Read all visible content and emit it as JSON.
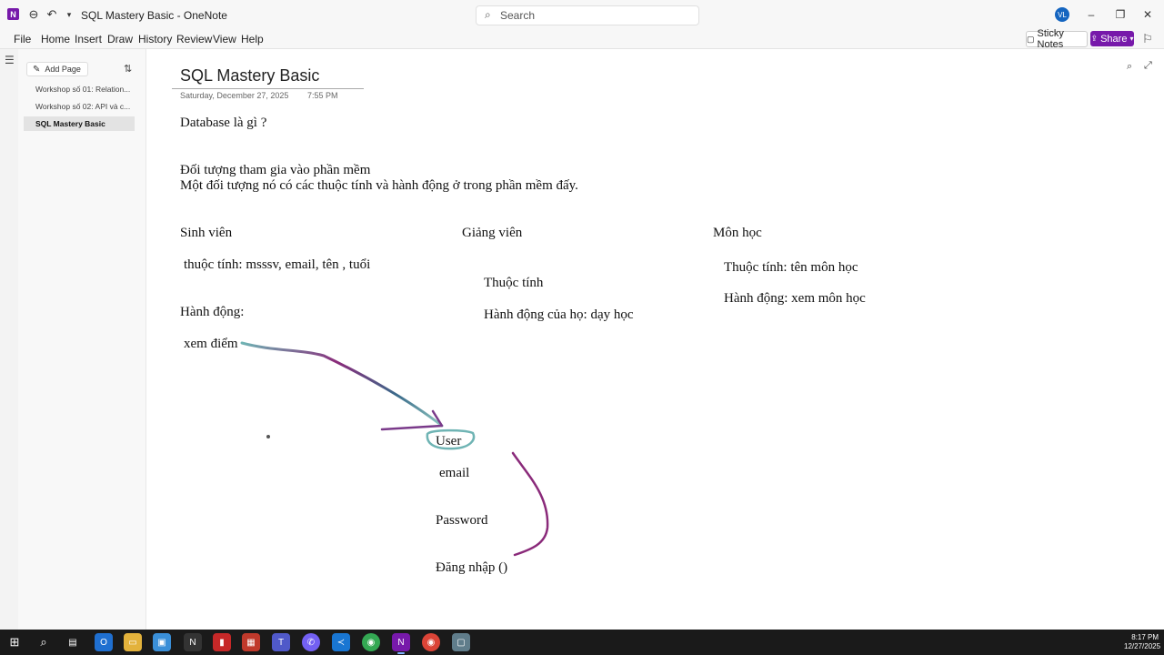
{
  "window": {
    "title": "SQL Mastery Basic - OneNote",
    "search_placeholder": "Search",
    "avatar_initials": "VL"
  },
  "menu": [
    "File",
    "Home",
    "Insert",
    "Draw",
    "History",
    "Review",
    "View",
    "Help"
  ],
  "toolbar_right": {
    "sticky_notes": "Sticky Notes",
    "share": "Share"
  },
  "sidebar": {
    "add_page": "Add Page",
    "pages": [
      {
        "label": "Workshop số 01: Relation...",
        "selected": false
      },
      {
        "label": "Workshop số 02: API và c...",
        "selected": false
      },
      {
        "label": "SQL Mastery Basic",
        "selected": true
      }
    ]
  },
  "page": {
    "title": "SQL Mastery Basic",
    "date": "Saturday, December 27, 2025",
    "time": "7:55 PM"
  },
  "notes": {
    "q1": "Database là gì ?",
    "line1": "Đối tượng tham gia vào phần mềm",
    "line2": "Một đối tượng nó có các thuộc tính và hành động ở trong phần mềm đấy.",
    "col1_head": "Sinh viên",
    "col1_attr": "thuộc tính: msssv, email, tên , tuổi",
    "col1_action": "Hành động:",
    "col1_action_item": "xem điểm",
    "col2_head": "Giảng viên",
    "col2_attr": "Thuộc tính",
    "col2_action": "Hành động của họ: dạy học",
    "col3_head": "Môn học",
    "col3_attr": "Thuộc tính: tên môn học",
    "col3_action": "Hành động: xem môn học",
    "user": "User",
    "email": "email",
    "password": "Password",
    "login": "Đăng nhập ()"
  },
  "taskbar": {
    "time": "8:17 PM",
    "date": "12/27/2025"
  },
  "colors": {
    "accent": "#7719aa",
    "ink_purple": "#8a2a7a",
    "ink_teal": "#6fb4b4"
  }
}
